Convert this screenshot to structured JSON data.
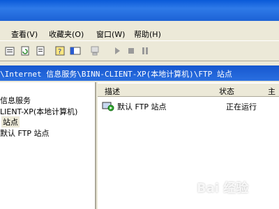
{
  "menu": {
    "items": [
      "查看(V)",
      "收藏夹(O)",
      "窗口(W)",
      "帮助(H)"
    ]
  },
  "address": {
    "path": "\\Internet 信息服务\\BINN-CLIENT-XP(本地计算机)\\FTP 站点"
  },
  "tree": {
    "items": [
      "信息服务",
      "LIENT-XP(本地计算机)",
      "站点",
      "默认 FTP 站点"
    ]
  },
  "list": {
    "columns": [
      "描述",
      "状态",
      "主"
    ],
    "rows": [
      {
        "description": "默认 FTP 站点",
        "state": "正在运行"
      }
    ]
  },
  "watermark": {
    "text": "Bai 经验"
  },
  "icons": [
    "properties-icon",
    "refresh-icon",
    "export-icon",
    "help-icon",
    "console-icon",
    "computer-icon",
    "play-icon",
    "stop-icon",
    "pause-icon",
    "ftp-site-icon"
  ]
}
